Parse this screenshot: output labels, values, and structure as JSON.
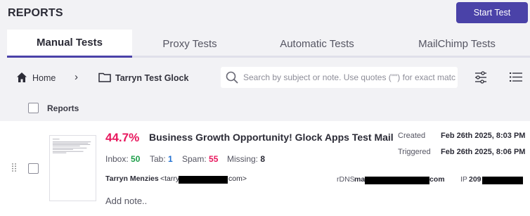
{
  "header": {
    "title": "REPORTS",
    "start_button": "Start Test"
  },
  "tabs": [
    {
      "label": "Manual Tests",
      "active": true
    },
    {
      "label": "Proxy Tests",
      "active": false
    },
    {
      "label": "Automatic Tests",
      "active": false
    },
    {
      "label": "MailChimp Tests",
      "active": false
    }
  ],
  "breadcrumb": {
    "home": "Home",
    "separator": "›",
    "folder": "Tarryn Test Glock"
  },
  "search": {
    "placeholder": "Search by subject or note. Use quotes (\"\") for exact matc"
  },
  "list_header": {
    "label": "Reports"
  },
  "report": {
    "score": "44.7%",
    "subject": "Business Growth Opportunity! Glock Apps Test Mail",
    "stats": {
      "inbox_label": "Inbox:",
      "inbox": "50",
      "tab_label": "Tab:",
      "tab": "1",
      "spam_label": "Spam:",
      "spam": "55",
      "missing_label": "Missing:",
      "missing": "8"
    },
    "created_label": "Created",
    "created": "Feb 26th 2025, 8:03 PM",
    "triggered_label": "Triggered",
    "triggered": "Feb 26th 2025, 8:06 PM",
    "sender_name": "Tarryn Menzies",
    "sender_email_start": "<tarry",
    "sender_email_end": "com>",
    "rdns_label": "rDNS",
    "rdns_start": "ma",
    "rdns_end": "com",
    "ip_label": "IP",
    "ip_start": "209",
    "add_note": "Add note.."
  },
  "colors": {
    "accent": "#4a42a8",
    "score": "#e8175d",
    "inbox": "#1e9e4a",
    "tab": "#1f6fd1",
    "spam": "#e8175d"
  }
}
